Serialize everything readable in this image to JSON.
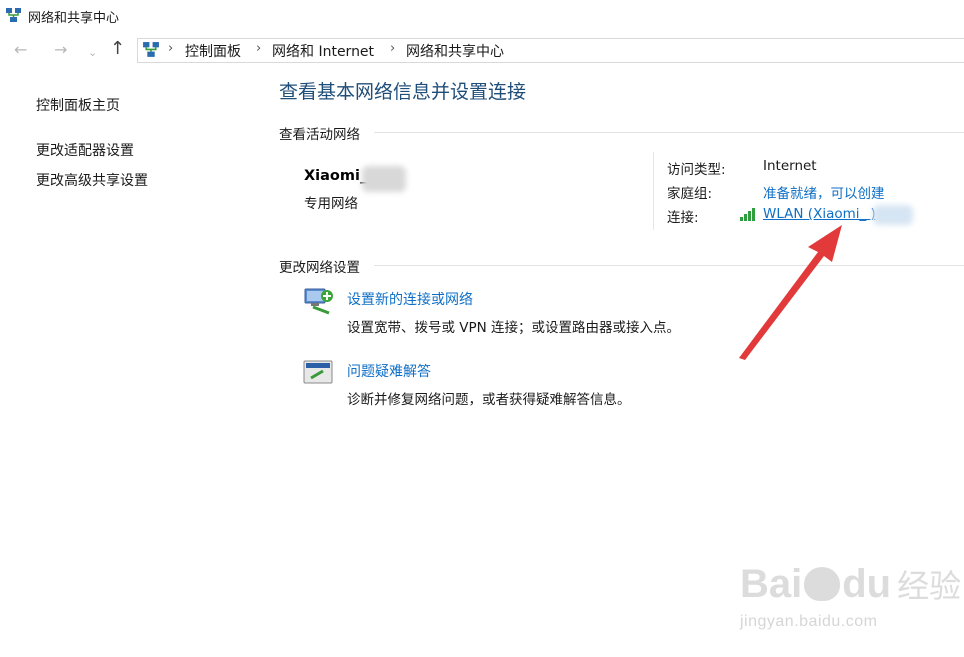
{
  "window": {
    "title": "网络和共享中心",
    "icon": "network-sharing-center-icon"
  },
  "nav": {
    "back_icon": "←",
    "forward_icon": "→",
    "recent_icon": "⌄",
    "up_icon": "↑",
    "breadcrumbs": [
      "控制面板",
      "网络和 Internet",
      "网络和共享中心"
    ],
    "separator": "›"
  },
  "sidebar": {
    "items": [
      {
        "label": "控制面板主页"
      },
      {
        "label": "更改适配器设置"
      },
      {
        "label": "更改高级共享设置"
      }
    ]
  },
  "main": {
    "title": "查看基本网络信息并设置连接",
    "active_networks_heading": "查看活动网络",
    "network": {
      "name": "Xiaomi_",
      "type": "专用网络"
    },
    "properties": {
      "access_type_label": "访问类型:",
      "access_type_value": "Internet",
      "homegroup_label": "家庭组:",
      "homegroup_value": "准备就绪，可以创建",
      "connection_label": "连接:",
      "connection_value": "WLAN (Xiaomi_       )"
    },
    "change_settings_heading": "更改网络设置",
    "tasks": [
      {
        "icon": "new-connection-icon",
        "link": "设置新的连接或网络",
        "desc": "设置宽带、拨号或 VPN 连接；或设置路由器或接入点。"
      },
      {
        "icon": "troubleshoot-icon",
        "link": "问题疑难解答",
        "desc": "诊断并修复网络问题，或者获得疑难解答信息。"
      }
    ]
  },
  "watermark": {
    "brand": "Bai",
    "brand2": "du",
    "suffix": "经验",
    "url": "jingyan.baidu.com"
  },
  "colors": {
    "title_blue": "#1f4e79",
    "link_blue": "#0f6fc6",
    "arrow_red": "#e23a3a"
  }
}
